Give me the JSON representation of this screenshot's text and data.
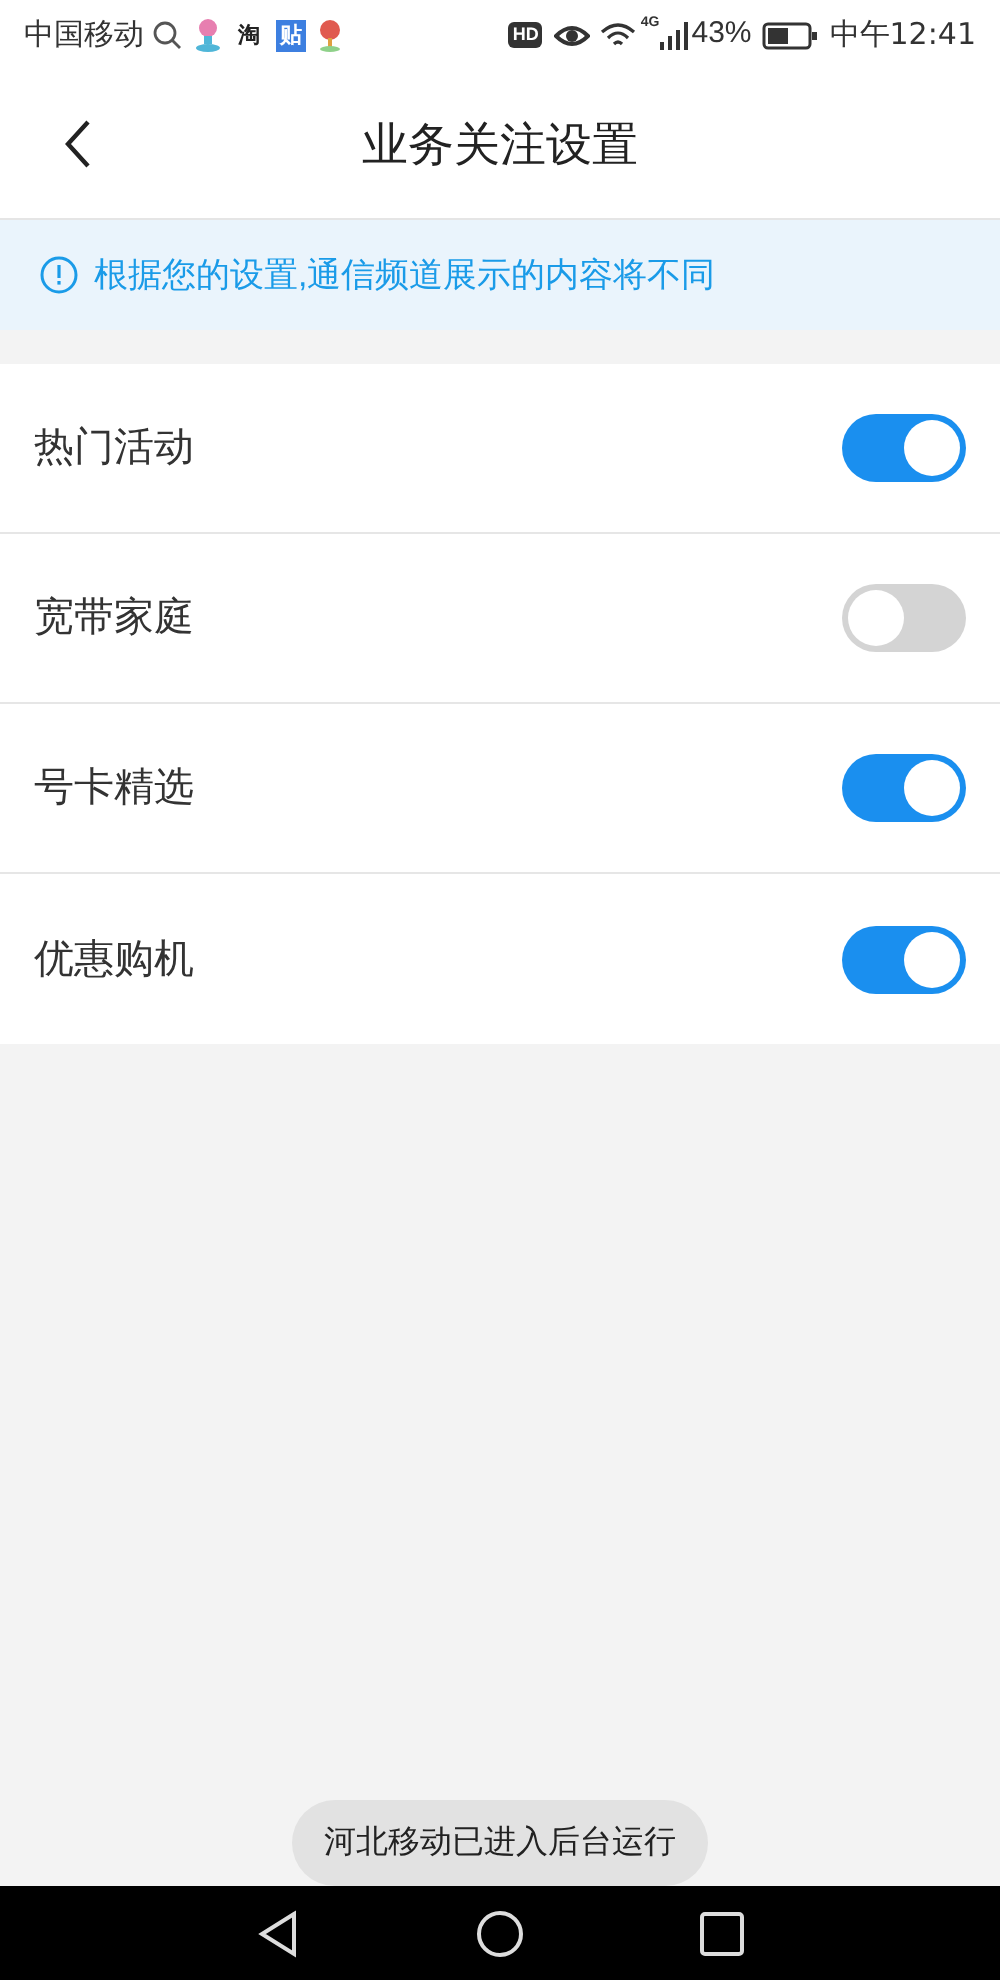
{
  "status_bar": {
    "carrier": "中国移动",
    "notifications": [
      {
        "kind": "search"
      },
      {
        "kind": "app"
      },
      {
        "kind": "badge",
        "label": "淘"
      },
      {
        "kind": "badge",
        "label": "贴"
      },
      {
        "kind": "pin"
      }
    ],
    "hd": "HD",
    "network": "4G",
    "battery": "43%",
    "time": "中午12:41"
  },
  "header": {
    "title": "业务关注设置"
  },
  "notice": {
    "text": "根据您的设置,通信频道展示的内容将不同"
  },
  "settings": [
    {
      "label": "热门活动",
      "on": true
    },
    {
      "label": "宽带家庭",
      "on": false
    },
    {
      "label": "号卡精选",
      "on": true
    },
    {
      "label": "优惠购机",
      "on": true
    }
  ],
  "toast": {
    "text": "河北移动已进入后台运行"
  }
}
